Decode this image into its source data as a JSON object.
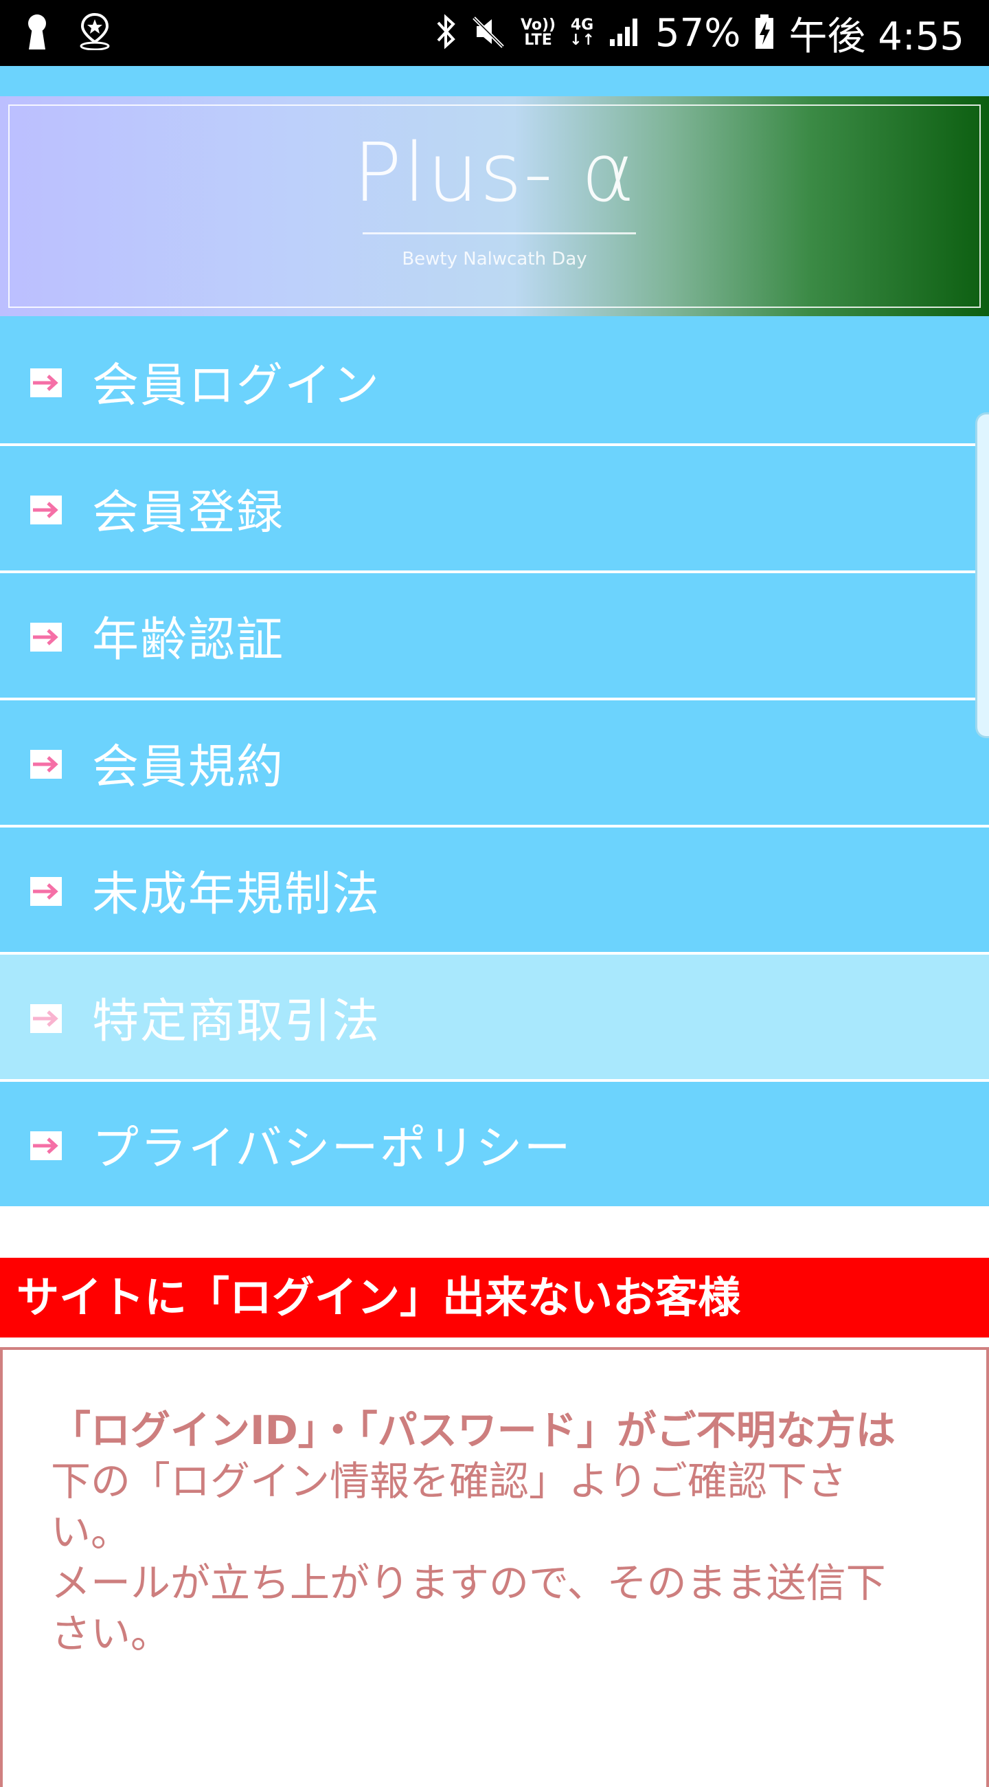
{
  "status_bar": {
    "battery": "57%",
    "time": "午後 4:55",
    "volte_top": "Vo))",
    "volte_bottom": "LTE",
    "net_top": "4G",
    "net_bottom": "↓↑"
  },
  "banner": {
    "title": "Plus- α",
    "subtitle": "Bewty Nalwcath Day"
  },
  "menu": {
    "items": [
      {
        "label": "会員ログイン"
      },
      {
        "label": "会員登録"
      },
      {
        "label": "年齢認証"
      },
      {
        "label": "会員規約"
      },
      {
        "label": "未成年規制法"
      },
      {
        "label": "特定商取引法"
      },
      {
        "label": "プライバシーポリシー"
      }
    ]
  },
  "notice": {
    "heading": "サイトに「ログイン」出来ないお客様",
    "bold_line": "「ログインID」・「パスワード」がご不明な方は",
    "line1": "下の「ログイン情報を確認」よりご確認下さい。",
    "line2": "メールが立ち上がりますので、そのまま送信下さい。"
  },
  "colors": {
    "menu_bg": "#6cd3fd",
    "menu_highlight": "#a9e8fd",
    "notice_red": "#ff0000",
    "notice_text": "#cd7e7e"
  }
}
